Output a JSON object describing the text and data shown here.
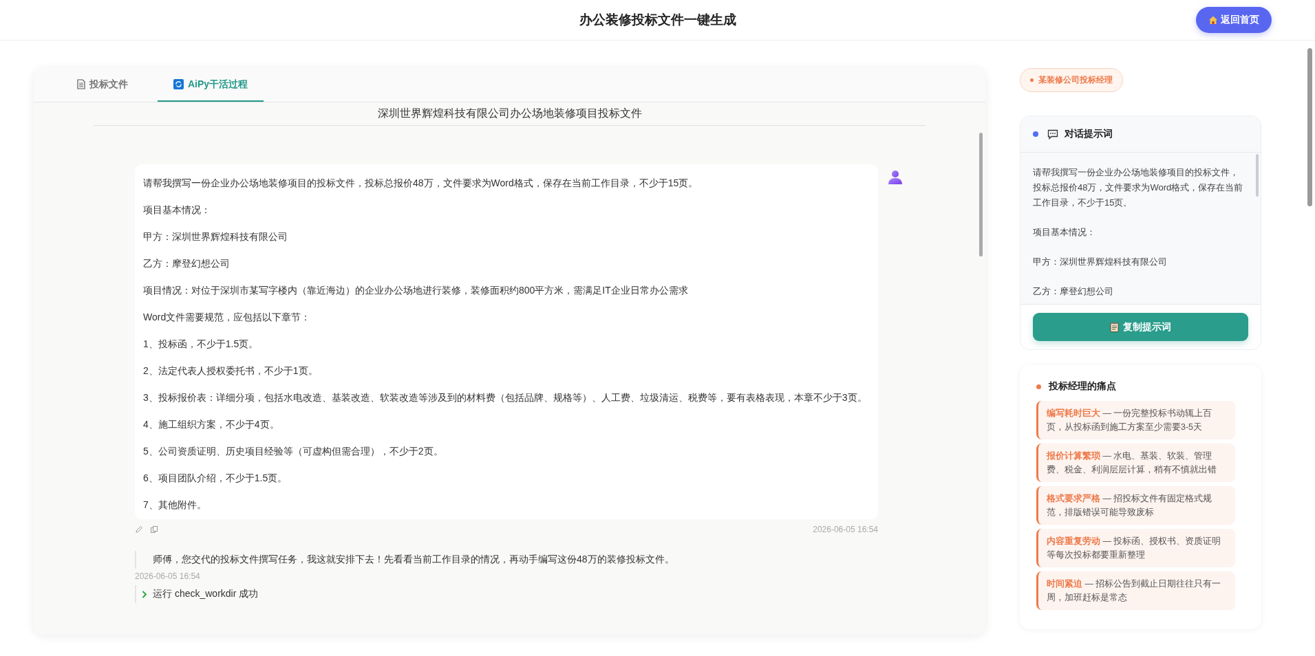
{
  "header": {
    "title": "办公装修投标文件一键生成",
    "back_button": "返回首页"
  },
  "tabs": [
    {
      "label": "投标文件",
      "selected": false,
      "kind": "document"
    },
    {
      "label": "AiPy干活过程",
      "selected": true,
      "kind": "aipy"
    }
  ],
  "document_title": "深圳世界辉煌科技有限公司办公场地装修项目投标文件",
  "chat": {
    "user_message": {
      "paragraphs": [
        "请帮我撰写一份企业办公场地装修项目的投标文件，投标总报价48万，文件要求为Word格式，保存在当前工作目录，不少于15页。",
        "项目基本情况：",
        "甲方：深圳世界辉煌科技有限公司",
        "乙方：摩登幻想公司",
        "项目情况：对位于深圳市某写字楼内（靠近海边）的企业办公场地进行装修，装修面积约800平方米，需满足IT企业日常办公需求",
        "Word文件需要规范，应包括以下章节：",
        "1、投标函，不少于1.5页。",
        "2、法定代表人授权委托书，不少于1页。",
        "3、投标报价表：详细分项，包括水电改造、基装改造、软装改造等涉及到的材料费（包括品牌、规格等）、人工费、垃圾清运、税费等，要有表格表现，本章不少于3页。",
        "4、施工组织方案，不少于4页。",
        "5、公司资质证明、历史项目经验等（可虚构但需合理），不少于2页。",
        "6、项目团队介绍，不少于1.5页。",
        "7、其他附件。"
      ],
      "time": "2026-06-05 16:54"
    },
    "reply": {
      "text": "师傅，您交代的投标文件撰写任务，我这就安排下去！先看看当前工作目录的情况，再动手编写这份48万的装修投标文件。",
      "time": "2026-06-05 16:54"
    },
    "step": {
      "text": "运行  check_workdir 成功"
    }
  },
  "role_badge": "某装修公司投标经理",
  "prompt_card": {
    "title": "对话提示词",
    "paragraphs": [
      "请帮我撰写一份企业办公场地装修项目的投标文件，投标总报价48万，文件要求为Word格式，保存在当前工作目录，不少于15页。",
      "项目基本情况：",
      "甲方：深圳世界辉煌科技有限公司",
      "乙方：摩登幻想公司"
    ],
    "copy_button": "复制提示词"
  },
  "pain_card": {
    "title": "投标经理的痛点",
    "items": [
      {
        "text": "**编写耗时巨大** — 一份完整投标书动辄上百页，从投标函到施工方案至少需要3-5天"
      },
      {
        "text": "**报价计算繁琐** — 水电、基装、软装、管理费、税金、利润层层计算，稍有不慎就出错"
      },
      {
        "text": "**格式要求严格** — 招投标文件有固定格式规范，排版错误可能导致废标"
      },
      {
        "text": "**内容重复劳动** — 投标函、授权书、资质证明等每次投标都要重新整理"
      },
      {
        "text": "**时间紧迫** — 招标公告到截止日期往往只有一周，加班赶标是常态"
      }
    ]
  }
}
